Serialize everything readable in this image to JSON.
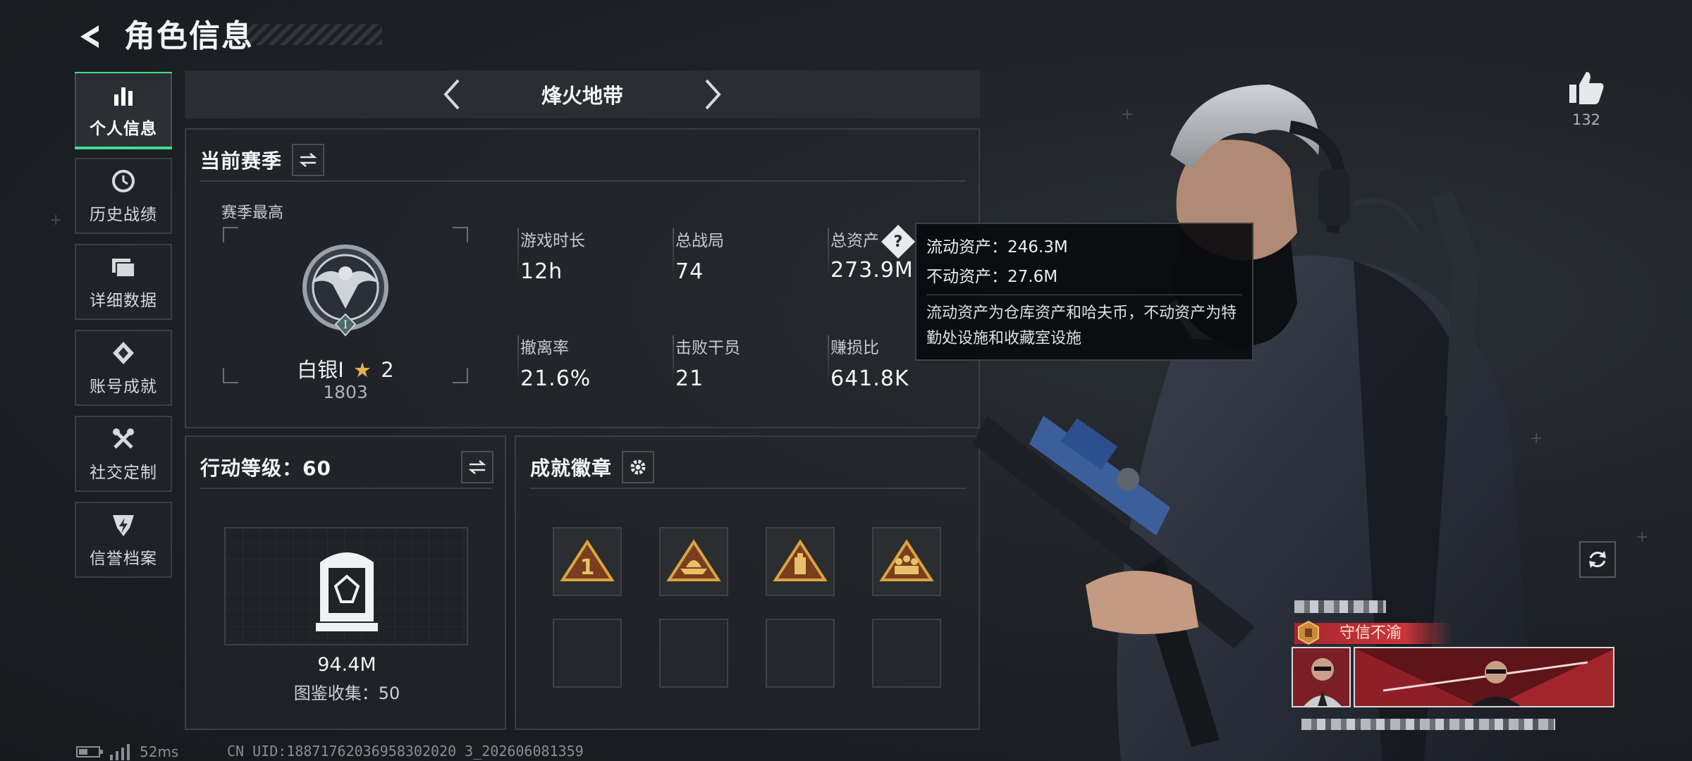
{
  "header": {
    "title": "角色信息"
  },
  "side_nav": {
    "items": [
      {
        "label": "个人信息",
        "icon": "bar-chart-icon",
        "active": true
      },
      {
        "label": "历史战绩",
        "icon": "history-clock-icon",
        "active": false
      },
      {
        "label": "详细数据",
        "icon": "folder-icon",
        "active": false
      },
      {
        "label": "账号成就",
        "icon": "medal-icon",
        "active": false
      },
      {
        "label": "社交定制",
        "icon": "tools-icon",
        "active": false
      },
      {
        "label": "信誉档案",
        "icon": "shield-bolt-icon",
        "active": false
      }
    ]
  },
  "mode": {
    "name": "烽火地带"
  },
  "season": {
    "title": "当前赛季",
    "best_label": "赛季最高",
    "rank_name": "白银I",
    "rank_stars": "2",
    "rank_score": "1803",
    "rank_tier_numeral": "I",
    "stats": [
      {
        "label": "游戏时长",
        "value": "12h"
      },
      {
        "label": "总战局",
        "value": "74"
      },
      {
        "label": "总资产",
        "value": "273.9M"
      },
      {
        "label": "撤离率",
        "value": "21.6%"
      },
      {
        "label": "击败干员",
        "value": "21"
      },
      {
        "label": "赚损比",
        "value": "641.8K"
      }
    ],
    "help_glyph": "?"
  },
  "tooltip": {
    "liquid": "流动资产：246.3M",
    "fixed": "不动资产：27.6M",
    "note": "流动资产为仓库资产和哈夫币，不动资产为特勤处设施和收藏室设施"
  },
  "level": {
    "title": "行动等级：60",
    "collection_value": "94.4M",
    "collection_count": "图鉴收集：50"
  },
  "badges": {
    "title": "成就徽章",
    "slots": [
      {
        "icon": "badge-number-one-icon",
        "filled": true
      },
      {
        "icon": "badge-boat-icon",
        "filled": true
      },
      {
        "icon": "badge-canister-icon",
        "filled": true
      },
      {
        "icon": "badge-team-icon",
        "filled": true
      },
      {
        "icon": "",
        "filled": false
      },
      {
        "icon": "",
        "filled": false
      },
      {
        "icon": "",
        "filled": false
      },
      {
        "icon": "",
        "filled": false
      }
    ]
  },
  "profile": {
    "likes": "132",
    "honor_title": "守信不渝"
  },
  "footer": {
    "latency": "52ms",
    "uid": "CN UID:18871762036958302020 3_202606081359"
  },
  "colors": {
    "accent_green": "#3ee08d",
    "badge_gold": "#d9a441",
    "honor_red": "#c8363b"
  }
}
